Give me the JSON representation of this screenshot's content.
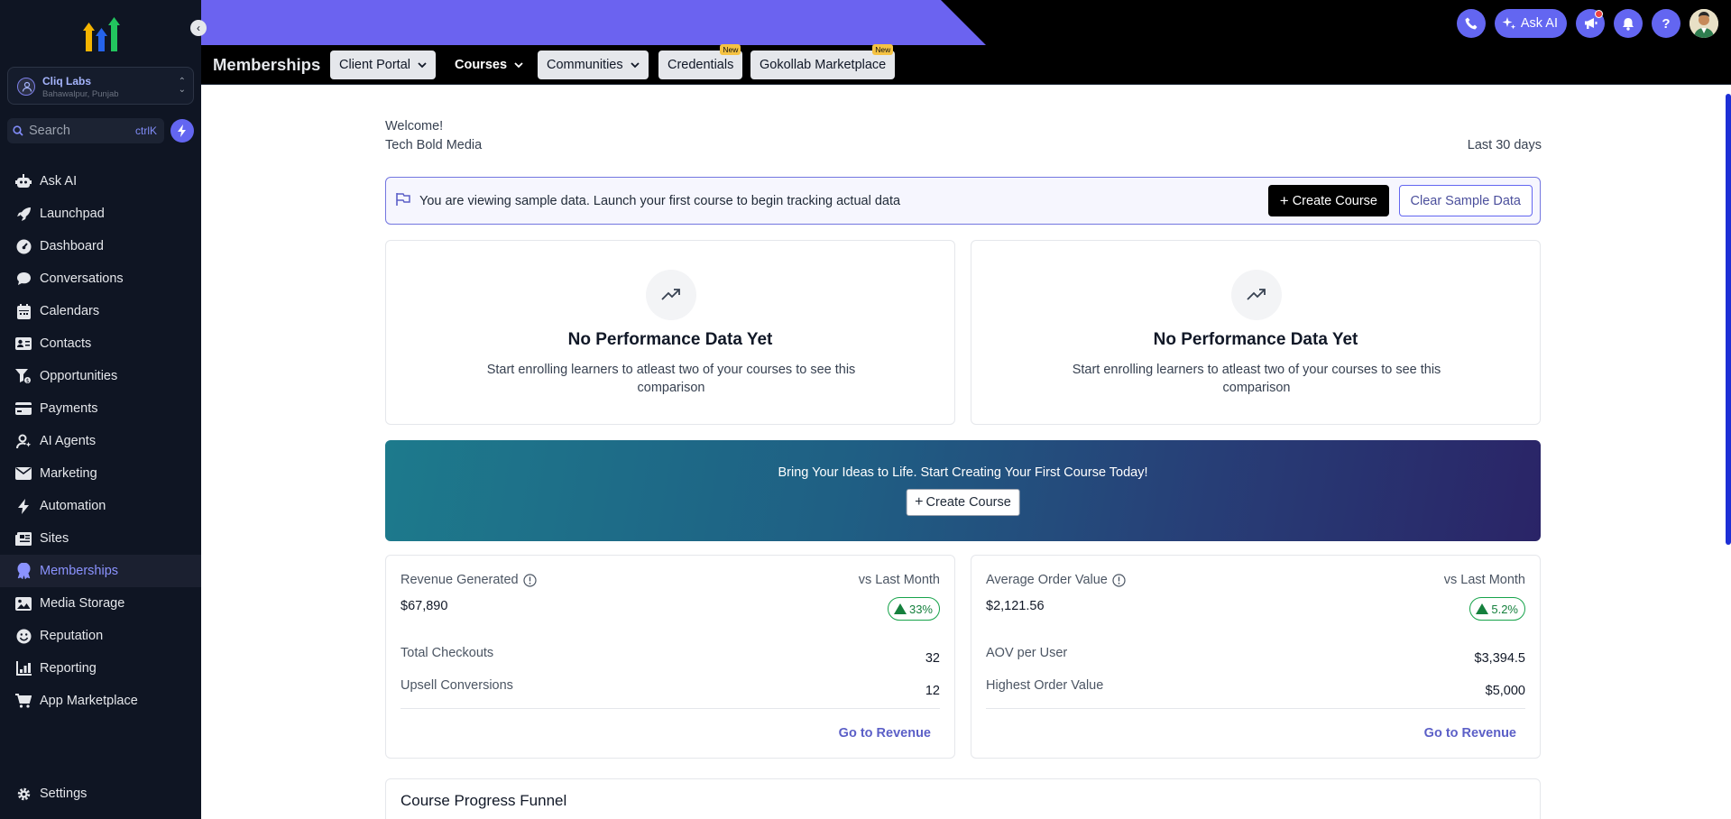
{
  "sidebar": {
    "location": {
      "name": "Cliq Labs",
      "address": "Bahawalpur, Punjab"
    },
    "search": {
      "placeholder": "Search",
      "shortcut": "ctrlK"
    },
    "items": [
      {
        "label": "Ask AI",
        "icon": "robot-icon"
      },
      {
        "label": "Launchpad",
        "icon": "rocket-icon"
      },
      {
        "label": "Dashboard",
        "icon": "gauge-icon"
      },
      {
        "label": "Conversations",
        "icon": "chat-icon"
      },
      {
        "label": "Calendars",
        "icon": "calendar-icon"
      },
      {
        "label": "Contacts",
        "icon": "contact-card-icon"
      },
      {
        "label": "Opportunities",
        "icon": "funnel-dollar-icon"
      },
      {
        "label": "Payments",
        "icon": "credit-card-icon"
      },
      {
        "label": "AI Agents",
        "icon": "user-ai-icon"
      },
      {
        "label": "Marketing",
        "icon": "envelope-icon"
      },
      {
        "label": "Automation",
        "icon": "bolt-icon"
      },
      {
        "label": "Sites",
        "icon": "newspaper-icon"
      },
      {
        "label": "Memberships",
        "icon": "award-icon",
        "active": true
      },
      {
        "label": "Media Storage",
        "icon": "image-icon"
      },
      {
        "label": "Reputation",
        "icon": "smile-icon"
      },
      {
        "label": "Reporting",
        "icon": "bar-chart-icon"
      },
      {
        "label": "App Marketplace",
        "icon": "cart-icon"
      }
    ],
    "settings": "Settings"
  },
  "topbar": {
    "ask_ai": "Ask AI"
  },
  "subnav": {
    "title": "Memberships",
    "tabs": {
      "client_portal": "Client Portal",
      "courses": "Courses",
      "communities": "Communities",
      "credentials": "Credentials",
      "marketplace": "Gokollab Marketplace",
      "new_badge": "New"
    }
  },
  "main": {
    "welcome": "Welcome!",
    "org": "Tech Bold Media",
    "range": "Last 30 days",
    "sample": {
      "text": "You are viewing sample data. Launch your first course to begin tracking actual data",
      "create": "Create Course",
      "clear": "Clear Sample Data"
    },
    "perf": {
      "title": "No Performance Data Yet",
      "desc": "Start enrolling learners to atleast two of your courses to see this comparison"
    },
    "banner": {
      "text": "Bring Your Ideas to Life. Start Creating Your First Course Today!",
      "button": "Create Course"
    },
    "revenue": {
      "label": "Revenue Generated",
      "vs": "vs Last Month",
      "value": "$67,890",
      "change": "33%",
      "rows": [
        {
          "label": "Total Checkouts",
          "value": "32"
        },
        {
          "label": "Upsell Conversions",
          "value": "12"
        }
      ],
      "link": "Go to Revenue"
    },
    "aov": {
      "label": "Average Order Value",
      "vs": "vs Last Month",
      "value": "$2,121.56",
      "change": "5.2%",
      "rows": [
        {
          "label": "AOV per User",
          "value": "$3,394.5"
        },
        {
          "label": "Highest Order Value",
          "value": "$5,000"
        }
      ],
      "link": "Go to Revenue"
    },
    "funnel": {
      "title": "Course Progress Funnel"
    }
  },
  "colors": {
    "accent": "#6366f1",
    "sidebar_bg": "#0f1523",
    "success": "#16a34a"
  }
}
